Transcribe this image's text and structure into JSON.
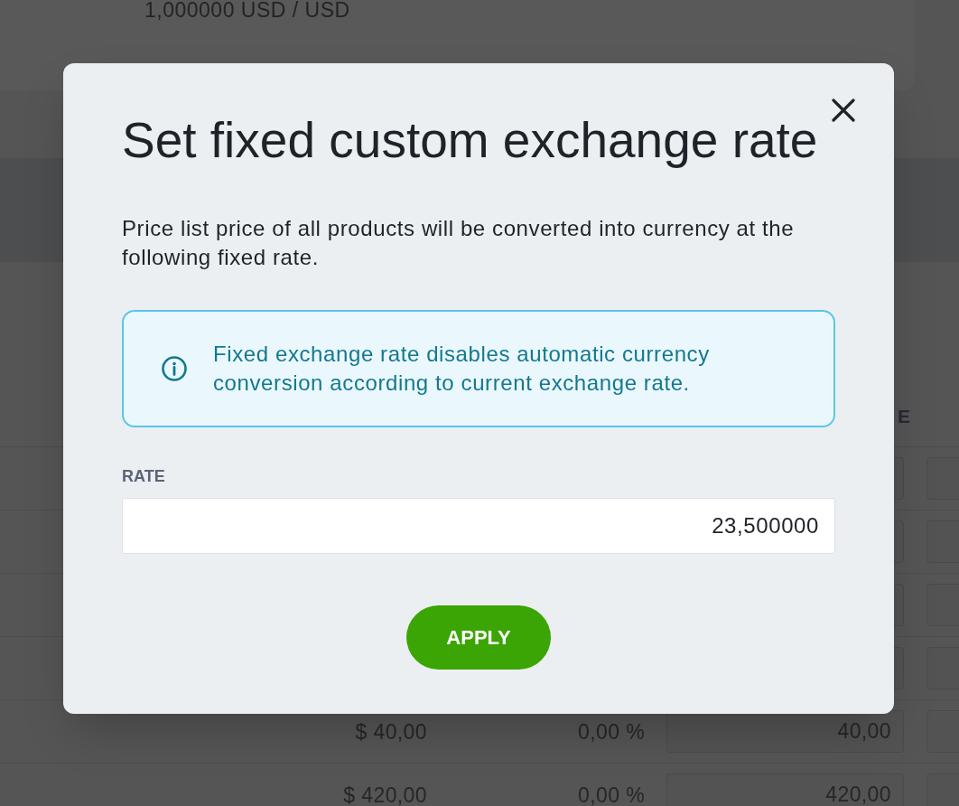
{
  "background_page": {
    "card_value": "1,000000 USD / USD",
    "table": {
      "column_header": "E",
      "rows": [
        {
          "cells": [
            "$ 40,00",
            "0,00 %"
          ],
          "field_value": "40,00"
        },
        {
          "cells": [
            "$ 420,00",
            "0,00 %"
          ],
          "field_value": "420,00"
        }
      ]
    }
  },
  "dialog": {
    "title": "Set fixed custom exchange rate",
    "description": "Price list price of all products will be converted into currency at the following fixed rate.",
    "info": "Fixed exchange rate disables automatic currency conversion according to current exchange rate.",
    "field": {
      "label": "RATE",
      "value": "23,500000"
    },
    "buttons": [
      "APPLY"
    ]
  }
}
